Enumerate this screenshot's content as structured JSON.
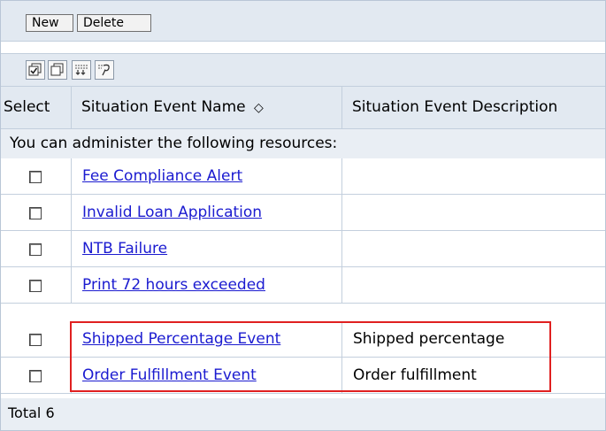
{
  "toolbar": {
    "new_label": "New",
    "delete_label": "Delete",
    "icons": [
      "select-all-icon",
      "deselect-all-icon",
      "show-filter-icon",
      "clear-filter-icon"
    ]
  },
  "table": {
    "columns": {
      "select": "Select",
      "name": "Situation Event Name",
      "sort_glyph": "◇",
      "description": "Situation Event Description"
    },
    "info_text": "You can administer the following resources:",
    "rows": [
      {
        "name": "Fee Compliance Alert",
        "description": ""
      },
      {
        "name": "Invalid Loan Application",
        "description": ""
      },
      {
        "name": "NTB Failure",
        "description": ""
      },
      {
        "name": "Print 72 hours exceeded",
        "description": ""
      },
      {
        "name": "Shipped Percentage Event",
        "description": "Shipped percentage"
      },
      {
        "name": "Order Fulfillment Event",
        "description": "Order fulfillment"
      }
    ],
    "total_text": "Total 6"
  },
  "colors": {
    "link": "#1b1bd0",
    "header_bg": "#e2e9f1",
    "highlight": "#e02020"
  }
}
